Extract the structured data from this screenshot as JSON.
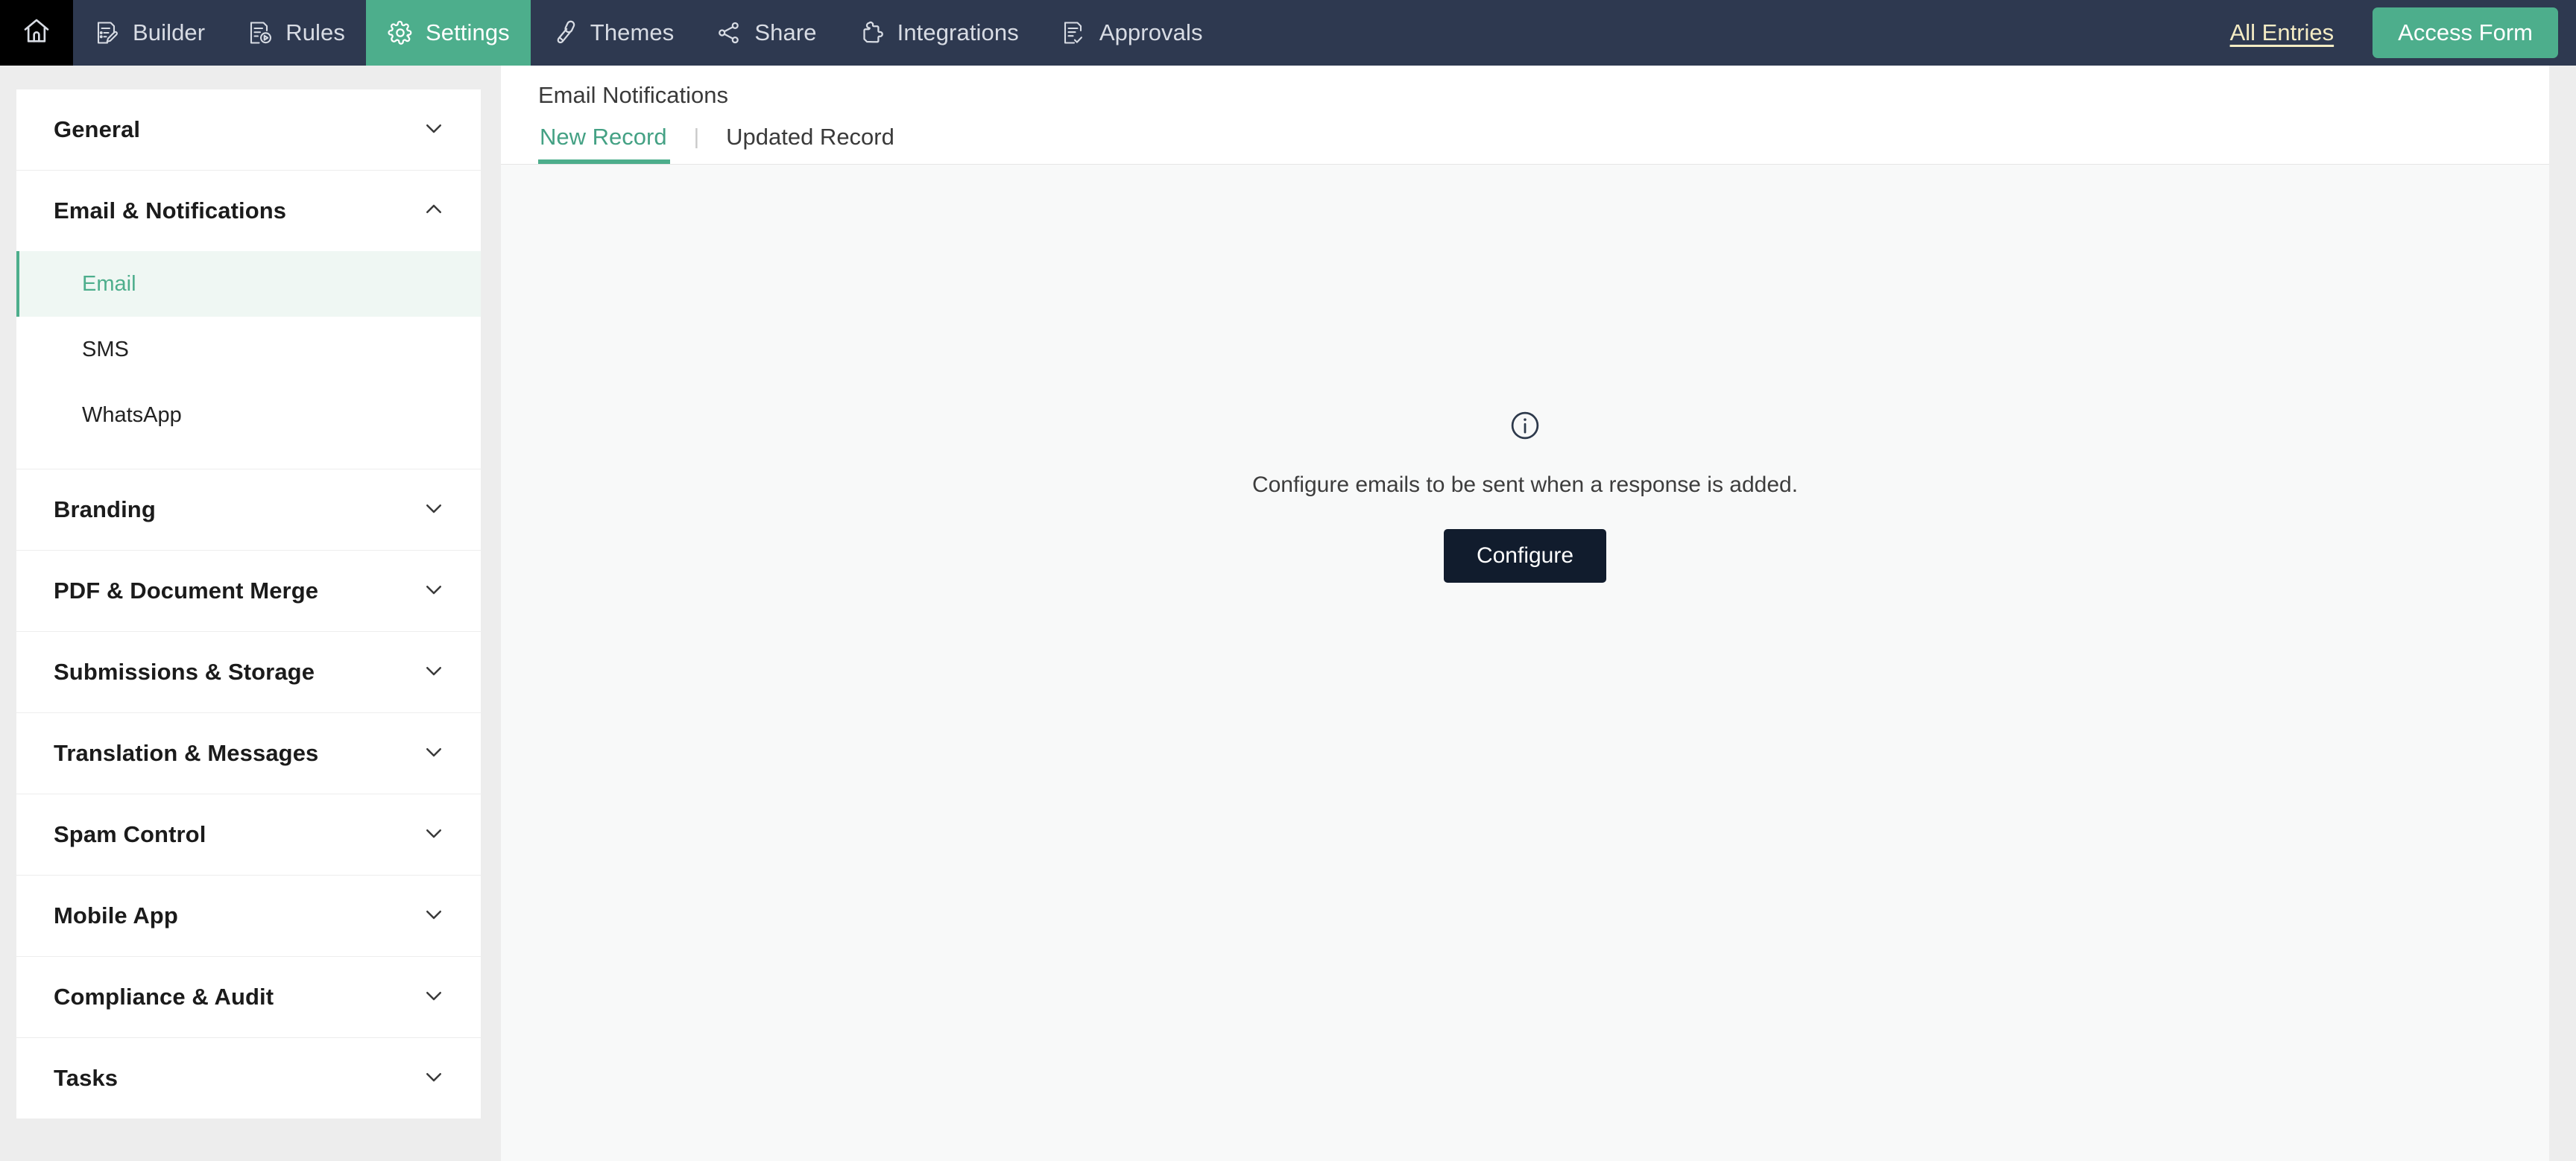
{
  "topnav": {
    "home_icon": "home-icon",
    "items": [
      {
        "label": "Builder",
        "icon": "document-pencil-icon",
        "active": false
      },
      {
        "label": "Rules",
        "icon": "document-rules-icon",
        "active": false
      },
      {
        "label": "Settings",
        "icon": "gear-icon",
        "active": true
      },
      {
        "label": "Themes",
        "icon": "paint-roller-icon",
        "active": false
      },
      {
        "label": "Share",
        "icon": "share-nodes-icon",
        "active": false
      },
      {
        "label": "Integrations",
        "icon": "puzzle-piece-icon",
        "active": false
      },
      {
        "label": "Approvals",
        "icon": "document-check-icon",
        "active": false
      }
    ],
    "all_entries_label": "All Entries",
    "access_form_label": "Access Form",
    "accent_color": "#4DAE8C",
    "bar_color": "#2E3950",
    "link_color": "#F4ECC4"
  },
  "sidebar": {
    "sections": [
      {
        "title": "General",
        "expanded": false,
        "items": []
      },
      {
        "title": "Email & Notifications",
        "expanded": true,
        "items": [
          {
            "label": "Email",
            "active": true
          },
          {
            "label": "SMS",
            "active": false
          },
          {
            "label": "WhatsApp",
            "active": false
          }
        ]
      },
      {
        "title": "Branding",
        "expanded": false,
        "items": []
      },
      {
        "title": "PDF & Document Merge",
        "expanded": false,
        "items": []
      },
      {
        "title": "Submissions & Storage",
        "expanded": false,
        "items": []
      },
      {
        "title": "Translation & Messages",
        "expanded": false,
        "items": []
      },
      {
        "title": "Spam Control",
        "expanded": false,
        "items": []
      },
      {
        "title": "Mobile App",
        "expanded": false,
        "items": []
      },
      {
        "title": "Compliance & Audit",
        "expanded": false,
        "items": []
      },
      {
        "title": "Tasks",
        "expanded": false,
        "items": []
      }
    ],
    "active_item_color": "#4DAE8C",
    "active_item_bg": "#EFF7F3"
  },
  "main": {
    "page_title": "Email Notifications",
    "tabs": [
      {
        "label": "New Record",
        "active": true
      },
      {
        "label": "Updated Record",
        "active": false
      }
    ],
    "tab_separator": "|",
    "empty_state": {
      "icon": "info-circle-icon",
      "message": "Configure emails to be sent when a response is added.",
      "button_label": "Configure",
      "button_color": "#111C2D"
    }
  }
}
